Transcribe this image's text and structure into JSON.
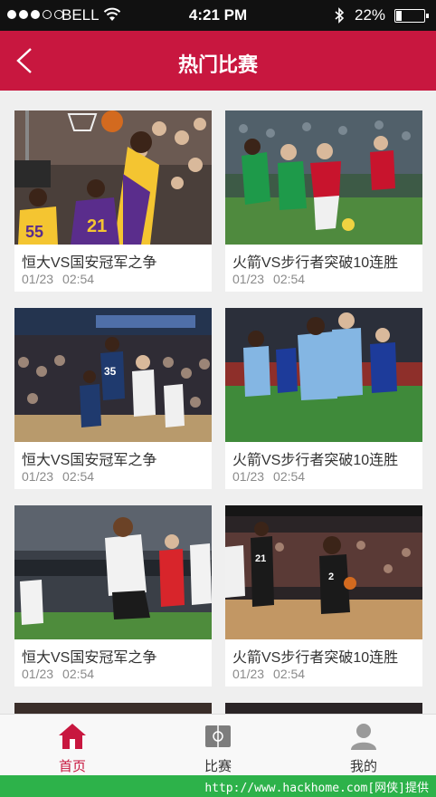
{
  "status_bar": {
    "carrier": "BELL",
    "time": "4:21 PM",
    "battery_percent": "22%",
    "battery_level": 0.22
  },
  "nav": {
    "title": "热门比赛"
  },
  "cards": [
    {
      "title": "恒大VS国安冠军之争",
      "date": "01/23",
      "time": "02:54",
      "scene": "basketball-lakers"
    },
    {
      "title": "火箭VS步行者突破10连胜",
      "date": "01/23",
      "time": "02:54",
      "scene": "soccer-red-vs-green"
    },
    {
      "title": "恒大VS国安冠军之争",
      "date": "01/23",
      "time": "02:54",
      "scene": "basketball-arena"
    },
    {
      "title": "火箭VS步行者突破10连胜",
      "date": "01/23",
      "time": "02:54",
      "scene": "soccer-celebration"
    },
    {
      "title": "恒大VS国安冠军之争",
      "date": "01/23",
      "time": "02:54",
      "scene": "soccer-white-kit"
    },
    {
      "title": "火箭VS步行者突破10连胜",
      "date": "01/23",
      "time": "02:54",
      "scene": "basketball-spurs"
    }
  ],
  "tabs": [
    {
      "label": "首页",
      "icon": "home-icon",
      "active": true
    },
    {
      "label": "比赛",
      "icon": "pitch-icon",
      "active": false
    },
    {
      "label": "我的",
      "icon": "user-icon",
      "active": false
    }
  ],
  "watermark": "http://www.hackhome.com[网侠]提供",
  "colors": {
    "brand": "#c8173f",
    "watermark_bar": "#2db24a"
  }
}
